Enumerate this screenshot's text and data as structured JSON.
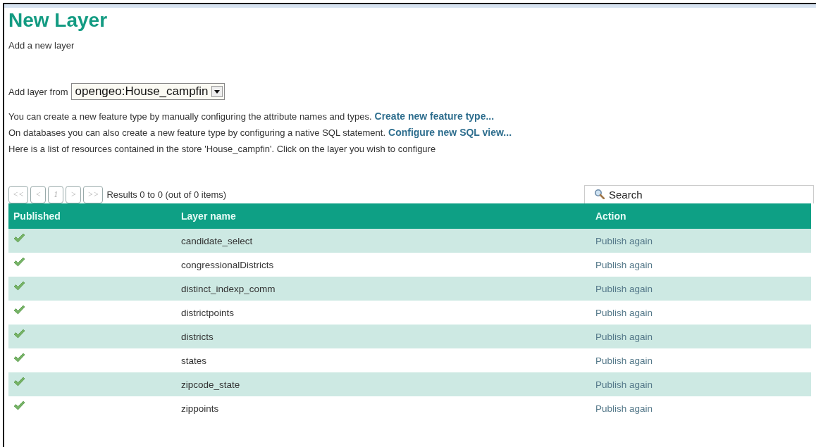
{
  "title": "New Layer",
  "subtitle": "Add a new layer",
  "source": {
    "label": "Add layer from",
    "value": "opengeo:House_campfin"
  },
  "paragraphs": [
    {
      "text": "You can create a new feature type by manually configuring the attribute names and types.",
      "link": "Create new feature type..."
    },
    {
      "text": "On databases you can also create a new feature type by configuring a native SQL statement.",
      "link": "Configure new SQL view..."
    },
    {
      "text": "Here is a list of resources contained in the store 'House_campfin'. Click on the layer you wish to configure"
    }
  ],
  "pager": {
    "buttons": [
      "<<",
      "<",
      "1",
      ">",
      ">>"
    ],
    "summary": "Results 0 to 0 (out of 0 items)"
  },
  "search": {
    "placeholder": "Search"
  },
  "table": {
    "columns": [
      "Published",
      "Layer name",
      "Action"
    ],
    "rows": [
      {
        "published": true,
        "name": "candidate_select",
        "action": "Publish again"
      },
      {
        "published": true,
        "name": "congressionalDistricts",
        "action": "Publish again"
      },
      {
        "published": true,
        "name": "distinct_indexp_comm",
        "action": "Publish again"
      },
      {
        "published": true,
        "name": "districtpoints",
        "action": "Publish again"
      },
      {
        "published": true,
        "name": "districts",
        "action": "Publish again"
      },
      {
        "published": true,
        "name": "states",
        "action": "Publish again"
      },
      {
        "published": true,
        "name": "zipcode_state",
        "action": "Publish again"
      },
      {
        "published": true,
        "name": "zippoints",
        "action": "Publish again"
      }
    ]
  }
}
